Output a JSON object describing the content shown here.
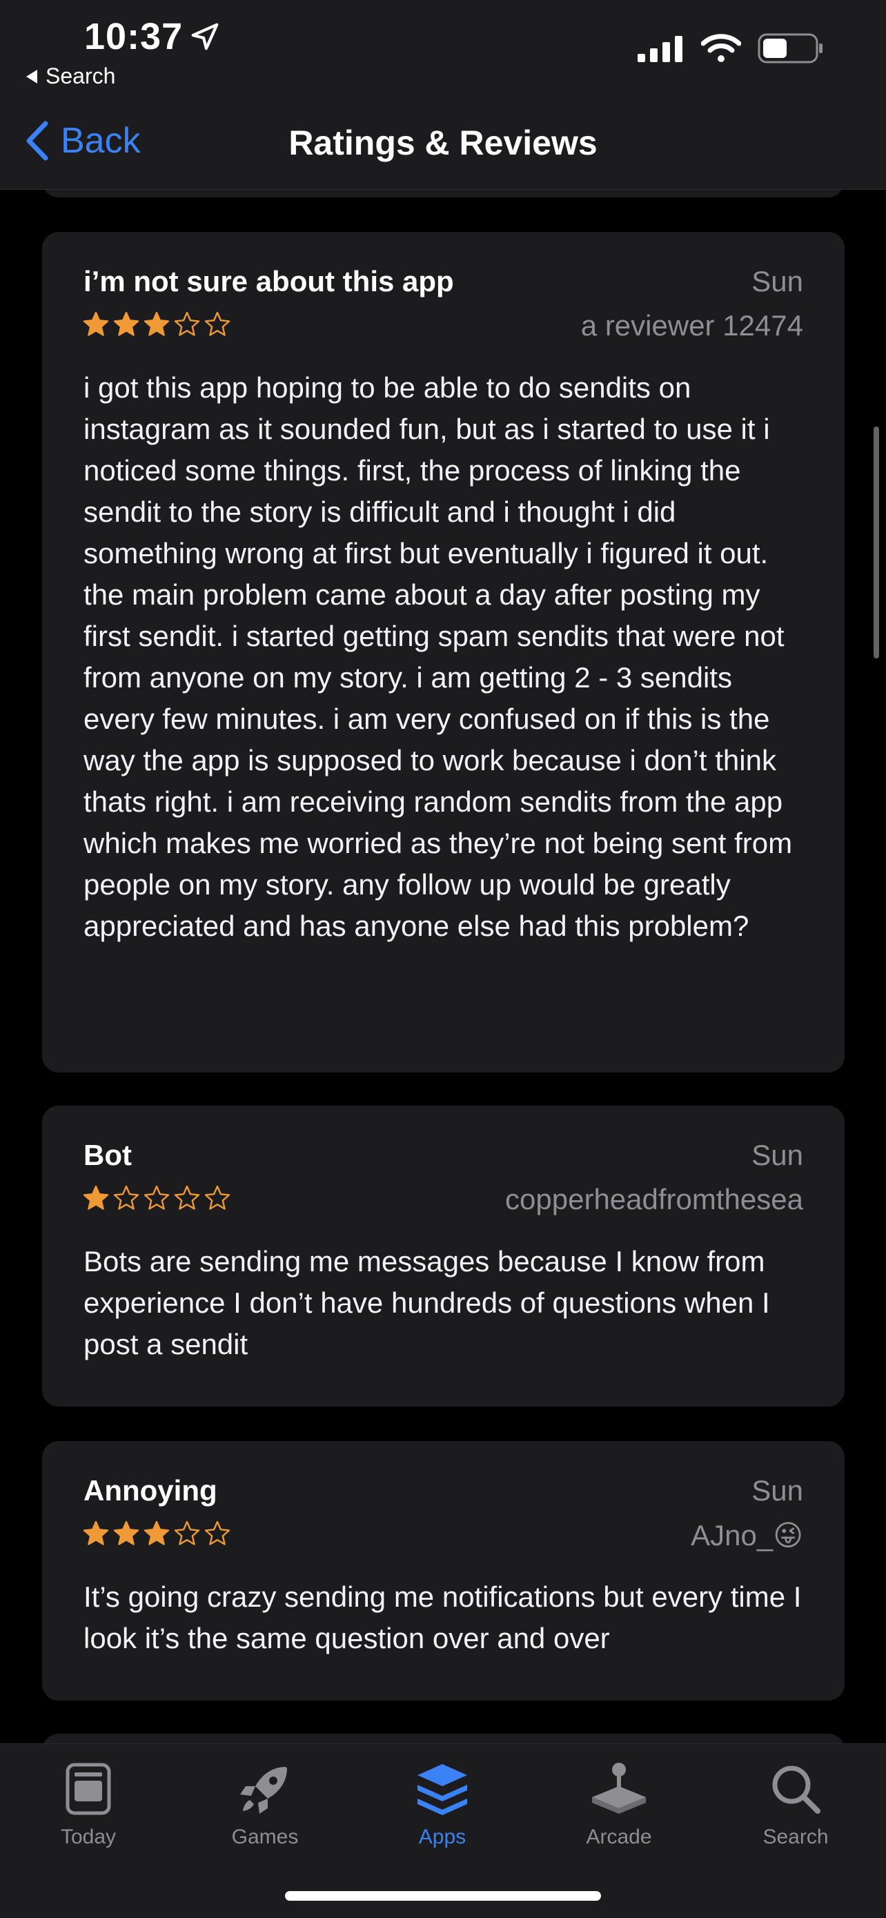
{
  "status": {
    "time": "10:37",
    "back_app": "Search"
  },
  "nav": {
    "back_label": "Back",
    "title": "Ratings & Reviews"
  },
  "colors": {
    "accent": "#3b82f6",
    "star": "#f09a37",
    "card": "#1c1c1e",
    "secondary_text": "#8e8e93"
  },
  "reviews": [
    {
      "title": "i’m not sure about this app",
      "date": "Sun",
      "author": "a reviewer 12474",
      "rating": 3,
      "body": "i got this app hoping to be able to do sendits on instagram as it sounded fun, but as i started to use it i noticed some things. first, the process of linking the sendit to the story is difficult and i thought i did something wrong at first but eventually i figured it out. the main problem came about a day after posting my first sendit. i started getting spam sendits that were not from anyone on my story. i am getting 2 - 3 sendits every few minutes. i am very confused on if this is the way the app is supposed to work because i don’t think thats right. i am receiving random sendits from the app which makes me worried as they’re not being sent from people on my story. any follow up would be greatly appreciated and has anyone else had this problem?"
    },
    {
      "title": "Bot",
      "date": "Sun",
      "author": "copperheadfromthesea",
      "rating": 1,
      "body": "Bots are sending me messages because I know from experience I don’t have hundreds of questions when I post a sendit"
    },
    {
      "title": "Annoying",
      "date": "Sun",
      "author": "AJno_😜",
      "rating": 3,
      "body": "It’s going crazy sending me notifications but every time I look it’s the same question over and over"
    }
  ],
  "tabs": [
    {
      "label": "Today",
      "icon": "today-icon",
      "active": false
    },
    {
      "label": "Games",
      "icon": "rocket-icon",
      "active": false
    },
    {
      "label": "Apps",
      "icon": "apps-stack-icon",
      "active": true
    },
    {
      "label": "Arcade",
      "icon": "joystick-icon",
      "active": false
    },
    {
      "label": "Search",
      "icon": "search-icon",
      "active": false
    }
  ]
}
